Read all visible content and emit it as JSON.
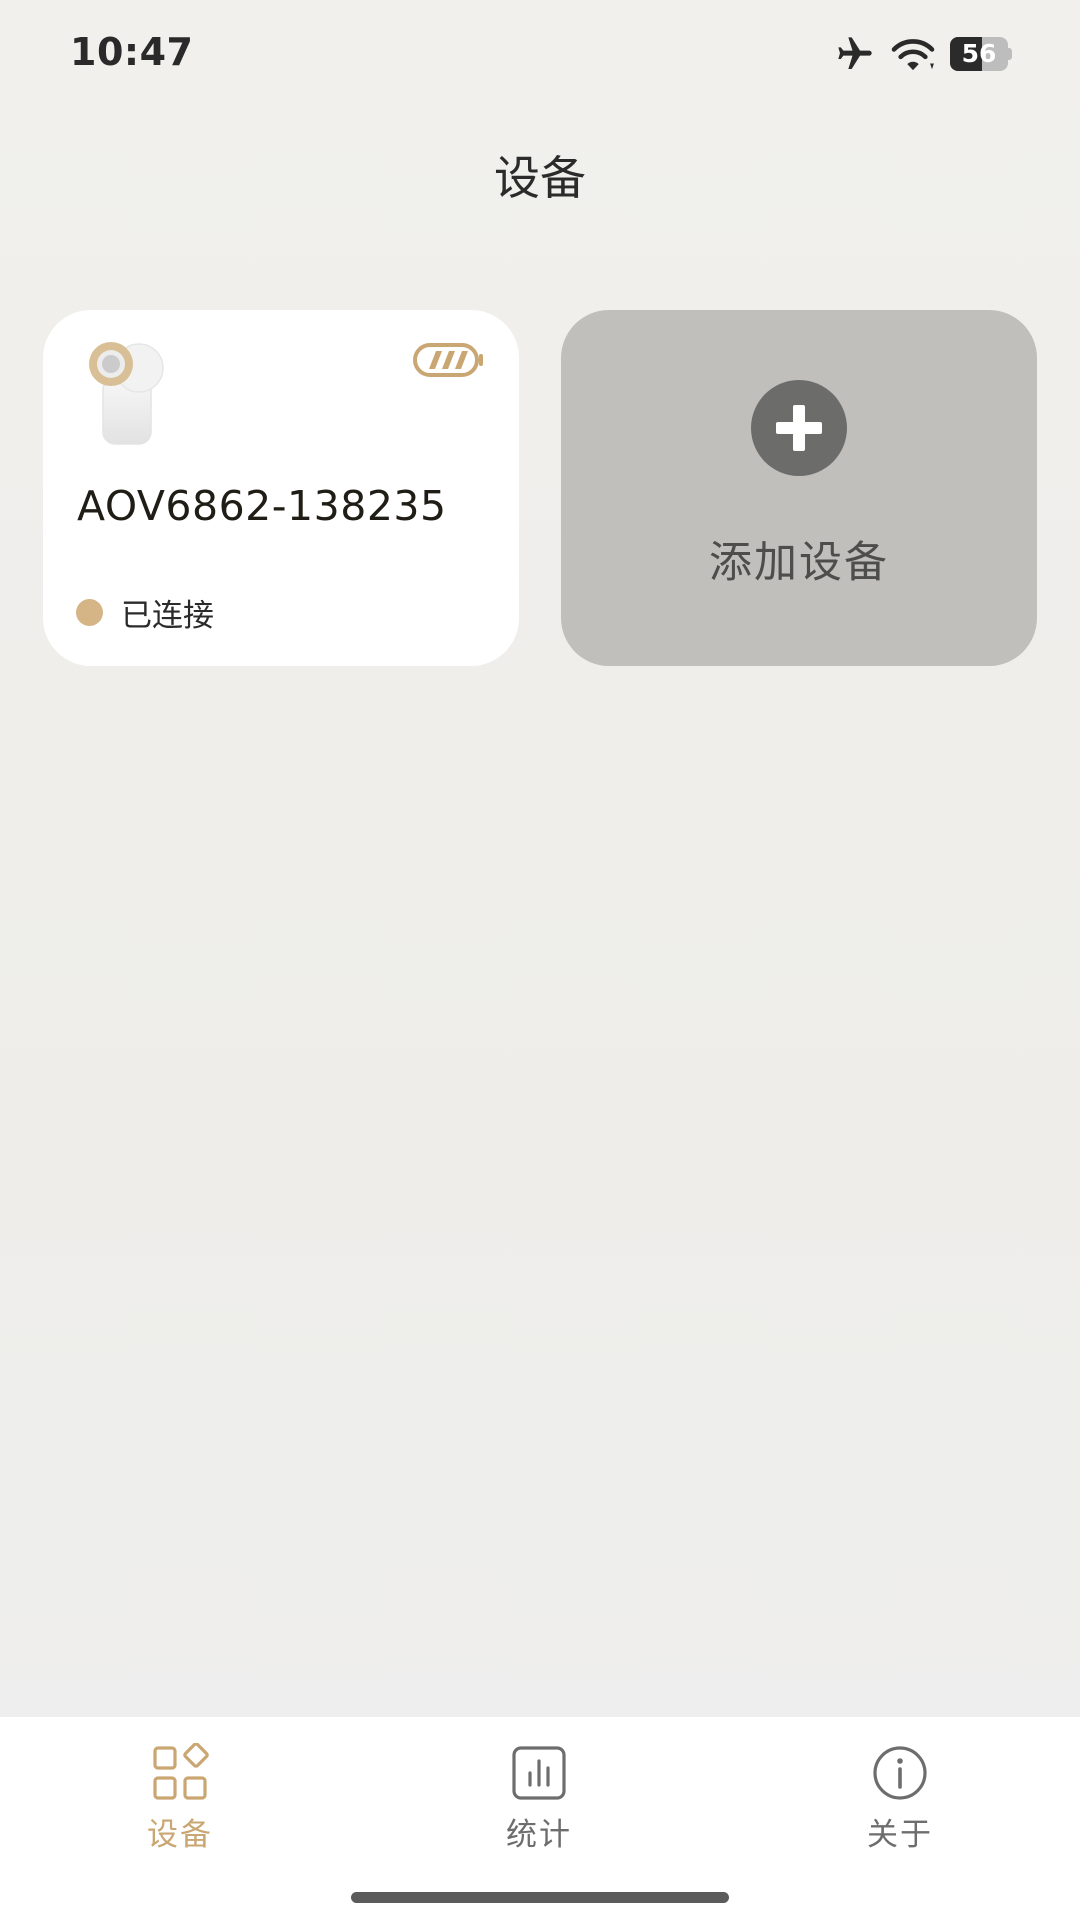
{
  "status_bar": {
    "time": "10:47",
    "battery_level": "56",
    "battery_fraction": 0.56,
    "icons": [
      "airplane-icon",
      "wifi-icon",
      "battery-icon"
    ]
  },
  "header": {
    "title": "设备"
  },
  "devices": [
    {
      "name": "AOV6862-138235",
      "status": "已连接",
      "status_color": "#d5b486",
      "battery_icon": "battery-icon"
    }
  ],
  "add_device": {
    "label": "添加设备",
    "icon": "plus-icon"
  },
  "bottom_nav": {
    "items": [
      {
        "label": "设备",
        "icon": "grid-icon",
        "active": true
      },
      {
        "label": "统计",
        "icon": "bar-chart-icon",
        "active": false
      },
      {
        "label": "关于",
        "icon": "info-icon",
        "active": false
      }
    ]
  },
  "colors": {
    "accent": "#c9a672",
    "background": "#f0efec",
    "add_card": "#c0bfbb",
    "text_primary": "#2b2b2b"
  }
}
